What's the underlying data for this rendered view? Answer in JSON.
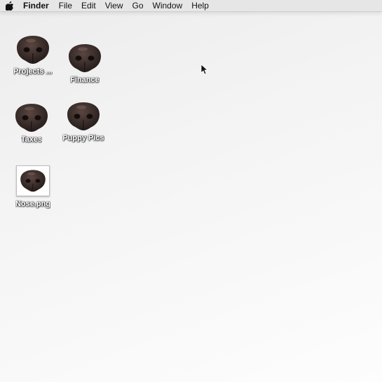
{
  "menubar": {
    "apple_icon": "apple-logo-icon",
    "app_name": "Finder",
    "items": [
      "File",
      "Edit",
      "View",
      "Go",
      "Window",
      "Help"
    ]
  },
  "desktop": {
    "icons": [
      {
        "label": "Projects ...",
        "type": "folder",
        "icon": "dog-nose-icon"
      },
      {
        "label": "Finance",
        "type": "folder",
        "icon": "dog-nose-icon"
      },
      {
        "label": "Taxes",
        "type": "folder",
        "icon": "dog-nose-icon"
      },
      {
        "label": "Puppy Pics",
        "type": "folder",
        "icon": "dog-nose-icon"
      },
      {
        "label": "Nose.png",
        "type": "image-file",
        "icon": "dog-nose-icon"
      }
    ]
  },
  "colors": {
    "nose_dark": "#2b2220",
    "nose_mid": "#4a3935",
    "menubar_bg": "#e6e6e6"
  }
}
